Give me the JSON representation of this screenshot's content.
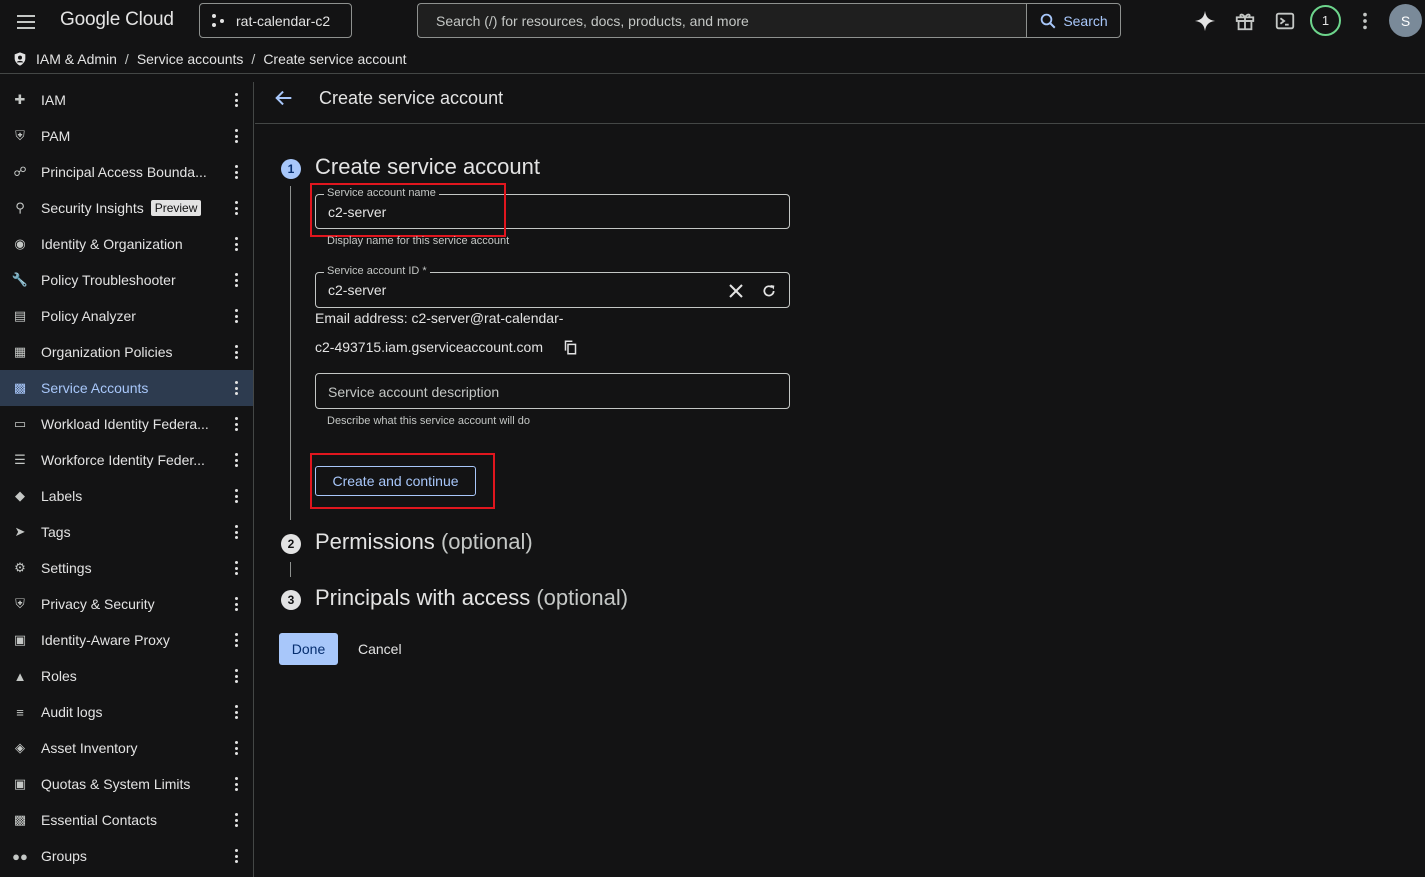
{
  "topbar": {
    "logo_text": "Google Cloud",
    "project": "rat-calendar-c2",
    "search_placeholder": "Search (/) for resources, docs, products, and more",
    "search_button": "Search",
    "notification_count": "1",
    "avatar_initial": "S"
  },
  "breadcrumb": {
    "items": [
      "IAM & Admin",
      "Service accounts",
      "Create service account"
    ],
    "separator": "/"
  },
  "sidebar": {
    "items": [
      {
        "label": "IAM",
        "icon": "person-add-icon"
      },
      {
        "label": "PAM",
        "icon": "shield-icon"
      },
      {
        "label": "Principal Access Bounda...",
        "icon": "boundary-icon"
      },
      {
        "label": "Security Insights",
        "icon": "insights-icon",
        "badge": "Preview"
      },
      {
        "label": "Identity & Organization",
        "icon": "account-circle-icon"
      },
      {
        "label": "Policy Troubleshooter",
        "icon": "wrench-icon"
      },
      {
        "label": "Policy Analyzer",
        "icon": "policy-analyzer-icon"
      },
      {
        "label": "Organization Policies",
        "icon": "list-box-icon"
      },
      {
        "label": "Service Accounts",
        "icon": "service-account-icon",
        "active": true
      },
      {
        "label": "Workload Identity Federa...",
        "icon": "card-icon"
      },
      {
        "label": "Workforce Identity Feder...",
        "icon": "list-icon"
      },
      {
        "label": "Labels",
        "icon": "label-icon"
      },
      {
        "label": "Tags",
        "icon": "tag-icon"
      },
      {
        "label": "Settings",
        "icon": "gear-icon"
      },
      {
        "label": "Privacy & Security",
        "icon": "shield-lock-icon"
      },
      {
        "label": "Identity-Aware Proxy",
        "icon": "proxy-icon"
      },
      {
        "label": "Roles",
        "icon": "hat-icon"
      },
      {
        "label": "Audit logs",
        "icon": "lines-icon"
      },
      {
        "label": "Asset Inventory",
        "icon": "asset-icon"
      },
      {
        "label": "Quotas & System Limits",
        "icon": "quota-icon"
      },
      {
        "label": "Essential Contacts",
        "icon": "contacts-icon"
      },
      {
        "label": "Groups",
        "icon": "groups-icon"
      }
    ]
  },
  "main": {
    "header_title": "Create service account",
    "step1": {
      "number": "1",
      "title": "Create service account",
      "name_label": "Service account name",
      "name_value": "c2-server",
      "name_helper": "Display name for this service account",
      "id_label": "Service account ID *",
      "id_value": "c2-server",
      "email_line1": "Email address: c2-server@rat-calendar-",
      "email_line2": "c2-493715.iam.gserviceaccount.com",
      "description_placeholder": "Service account description",
      "description_helper": "Describe what this service account will do",
      "create_button": "Create and continue"
    },
    "step2": {
      "number": "2",
      "title": "Permissions",
      "optional": "(optional)"
    },
    "step3": {
      "number": "3",
      "title": "Principals with access",
      "optional": "(optional)"
    },
    "done_button": "Done",
    "cancel_button": "Cancel"
  },
  "colors": {
    "background": "#131314",
    "accent": "#a8c7fa",
    "active_nav": "#2d3b4f",
    "highlight_box": "#e0161e"
  }
}
